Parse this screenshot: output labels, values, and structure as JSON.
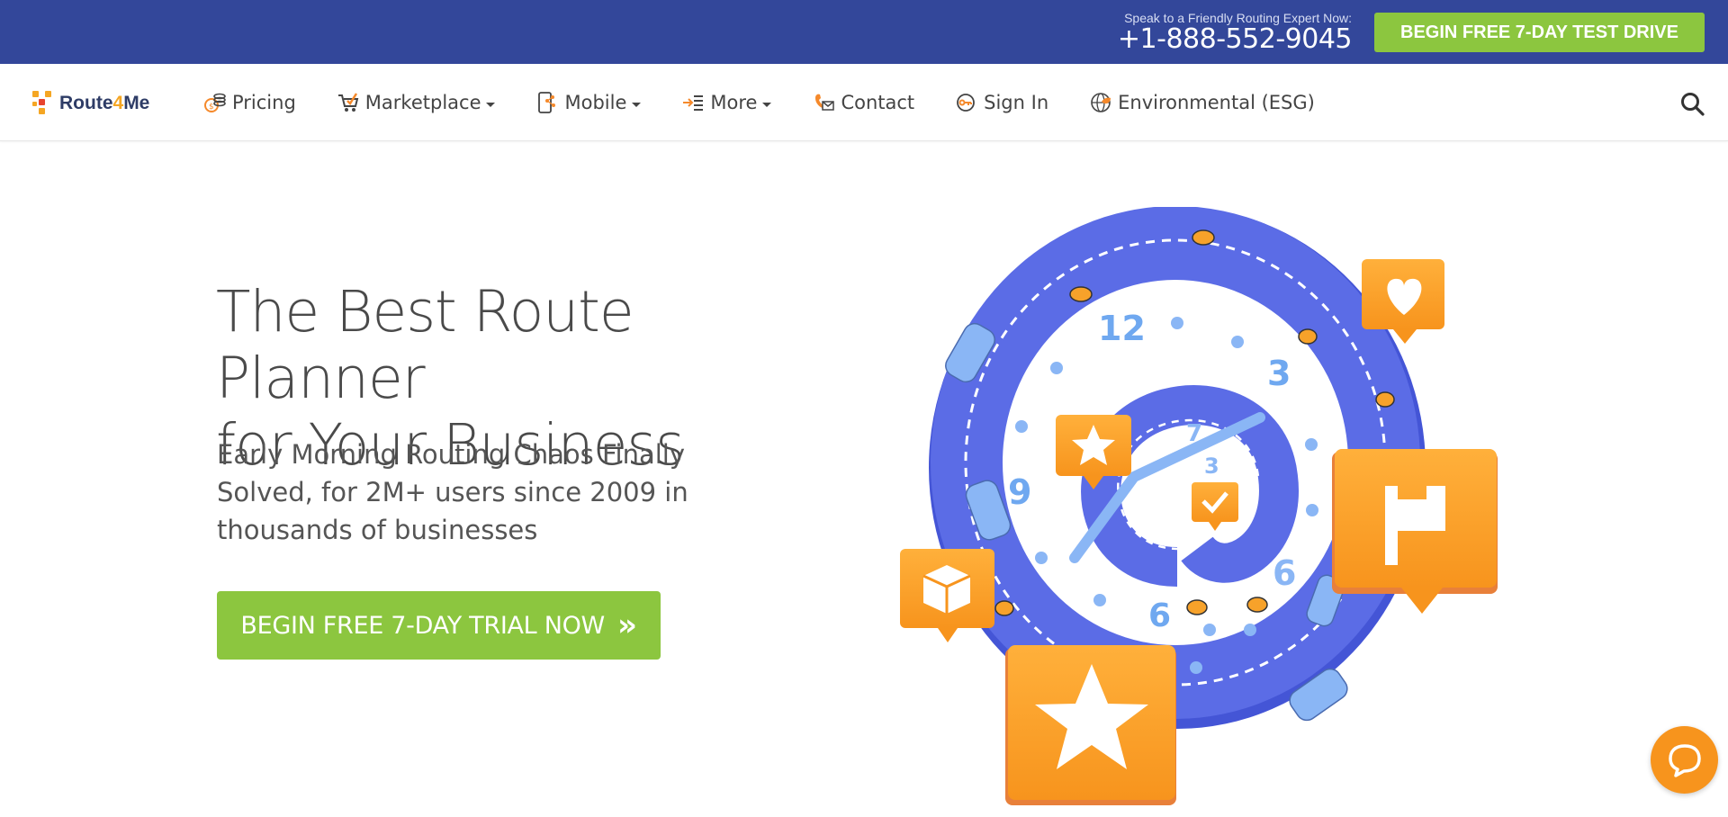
{
  "topbar": {
    "speak_label": "Speak to a Friendly Routing Expert Now:",
    "phone": "+1-888-552-9045",
    "cta_label": "BEGIN FREE 7-DAY TEST DRIVE"
  },
  "nav": {
    "logo_prefix": "Route",
    "logo_number": "4",
    "logo_suffix": "Me",
    "items": [
      {
        "label": "Pricing",
        "icon": "coins-icon",
        "dropdown": false
      },
      {
        "label": "Marketplace",
        "icon": "cart-icon",
        "dropdown": true
      },
      {
        "label": "Mobile",
        "icon": "mobile-icon",
        "dropdown": true
      },
      {
        "label": "More",
        "icon": "list-icon",
        "dropdown": true
      },
      {
        "label": "Contact",
        "icon": "phone-mail-icon",
        "dropdown": false
      },
      {
        "label": "Sign In",
        "icon": "key-icon",
        "dropdown": false
      },
      {
        "label": "Environmental (ESG)",
        "icon": "globe-icon",
        "dropdown": false
      }
    ]
  },
  "hero": {
    "title_line1": "The Best Route Planner",
    "title_line2": "for Your Business",
    "subtitle": "Early Morning Routing Chaos Finally Solved, for 2M+ users since 2009 in thousands of businesses",
    "cta_label": "BEGIN FREE 7-DAY TRIAL NOW",
    "cta_chevron": "»"
  },
  "illustration": {
    "clock_numbers": [
      "12",
      "3",
      "9",
      "6"
    ],
    "inner_numbers": [
      "3",
      "6",
      "7",
      "9"
    ]
  },
  "colors": {
    "topbar": "#33479a",
    "green": "#8cc63f",
    "orange": "#f7a22a",
    "track_blue": "#5b6ce6"
  }
}
